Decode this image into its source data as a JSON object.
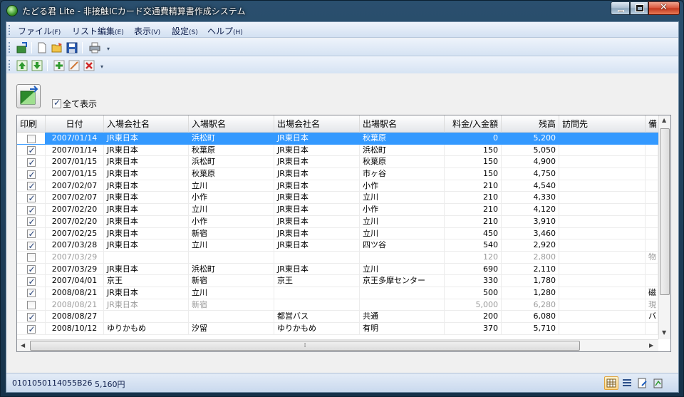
{
  "window": {
    "title": "たどる君  Lite - 非接触ICカード交通費精算書作成システム"
  },
  "menu": [
    {
      "label": "ファイル",
      "acc": "(F)"
    },
    {
      "label": "リスト編集",
      "acc": "(E)"
    },
    {
      "label": "表示",
      "acc": "(V)"
    },
    {
      "label": "設定",
      "acc": "(S)"
    },
    {
      "label": "ヘルプ",
      "acc": "(H)"
    }
  ],
  "toolbar1": [
    "import-icon",
    "new-icon",
    "open-icon",
    "save-icon",
    "print-icon"
  ],
  "toolbar2": [
    "move-up-icon",
    "move-down-icon",
    "add-row-icon",
    "edit-row-icon",
    "delete-row-icon"
  ],
  "show_all": {
    "label": "全て表示",
    "checked": true
  },
  "table": {
    "columns": [
      "印刷",
      "日付",
      "入場会社名",
      "入場駅名",
      "出場会社名",
      "出場駅名",
      "料金/入金額",
      "残高",
      "訪問先",
      "備"
    ],
    "rows": [
      {
        "print": false,
        "date": "2007/01/14",
        "in_co": "JR東日本",
        "in_st": "浜松町",
        "out_co": "JR東日本",
        "out_st": "秋葉原",
        "fare": "0",
        "bal": "5,200",
        "visit": "",
        "note": "",
        "selected": true
      },
      {
        "print": true,
        "date": "2007/01/14",
        "in_co": "JR東日本",
        "in_st": "秋葉原",
        "out_co": "JR東日本",
        "out_st": "浜松町",
        "fare": "150",
        "bal": "5,050",
        "visit": "",
        "note": ""
      },
      {
        "print": true,
        "date": "2007/01/15",
        "in_co": "JR東日本",
        "in_st": "浜松町",
        "out_co": "JR東日本",
        "out_st": "秋葉原",
        "fare": "150",
        "bal": "4,900",
        "visit": "",
        "note": ""
      },
      {
        "print": true,
        "date": "2007/01/15",
        "in_co": "JR東日本",
        "in_st": "秋葉原",
        "out_co": "JR東日本",
        "out_st": "市ヶ谷",
        "fare": "150",
        "bal": "4,750",
        "visit": "",
        "note": ""
      },
      {
        "print": true,
        "date": "2007/02/07",
        "in_co": "JR東日本",
        "in_st": "立川",
        "out_co": "JR東日本",
        "out_st": "小作",
        "fare": "210",
        "bal": "4,540",
        "visit": "",
        "note": ""
      },
      {
        "print": true,
        "date": "2007/02/07",
        "in_co": "JR東日本",
        "in_st": "小作",
        "out_co": "JR東日本",
        "out_st": "立川",
        "fare": "210",
        "bal": "4,330",
        "visit": "",
        "note": ""
      },
      {
        "print": true,
        "date": "2007/02/20",
        "in_co": "JR東日本",
        "in_st": "立川",
        "out_co": "JR東日本",
        "out_st": "小作",
        "fare": "210",
        "bal": "4,120",
        "visit": "",
        "note": ""
      },
      {
        "print": true,
        "date": "2007/02/20",
        "in_co": "JR東日本",
        "in_st": "小作",
        "out_co": "JR東日本",
        "out_st": "立川",
        "fare": "210",
        "bal": "3,910",
        "visit": "",
        "note": ""
      },
      {
        "print": true,
        "date": "2007/02/25",
        "in_co": "JR東日本",
        "in_st": "新宿",
        "out_co": "JR東日本",
        "out_st": "立川",
        "fare": "450",
        "bal": "3,460",
        "visit": "",
        "note": ""
      },
      {
        "print": true,
        "date": "2007/03/28",
        "in_co": "JR東日本",
        "in_st": "立川",
        "out_co": "JR東日本",
        "out_st": "四ツ谷",
        "fare": "540",
        "bal": "2,920",
        "visit": "",
        "note": ""
      },
      {
        "print": false,
        "date": "2007/03/29",
        "in_co": "",
        "in_st": "",
        "out_co": "",
        "out_st": "",
        "fare": "120",
        "bal": "2,800",
        "visit": "",
        "note": "物",
        "dim": true
      },
      {
        "print": true,
        "date": "2007/03/29",
        "in_co": "JR東日本",
        "in_st": "浜松町",
        "out_co": "JR東日本",
        "out_st": "立川",
        "fare": "690",
        "bal": "2,110",
        "visit": "",
        "note": ""
      },
      {
        "print": true,
        "date": "2007/04/01",
        "in_co": "京王",
        "in_st": "新宿",
        "out_co": "京王",
        "out_st": "京王多摩センター",
        "fare": "330",
        "bal": "1,780",
        "visit": "",
        "note": ""
      },
      {
        "print": true,
        "date": "2008/08/21",
        "in_co": "JR東日本",
        "in_st": "立川",
        "out_co": "",
        "out_st": "",
        "fare": "500",
        "bal": "1,280",
        "visit": "",
        "note": "磁"
      },
      {
        "print": false,
        "date": "2008/08/21",
        "in_co": "JR東日本",
        "in_st": "新宿",
        "out_co": "",
        "out_st": "",
        "fare": "5,000",
        "bal": "6,280",
        "visit": "",
        "note": "現",
        "dim": true
      },
      {
        "print": true,
        "date": "2008/08/27",
        "in_co": "",
        "in_st": "",
        "out_co": "都営バス",
        "out_st": "共通",
        "fare": "200",
        "bal": "6,080",
        "visit": "",
        "note": "バ"
      },
      {
        "print": true,
        "date": "2008/10/12",
        "in_co": "ゆりかもめ",
        "in_st": "汐留",
        "out_co": "ゆりかもめ",
        "out_st": "有明",
        "fare": "370",
        "bal": "5,710",
        "visit": "",
        "note": ""
      }
    ]
  },
  "status": {
    "card_id": "0101050114055B26",
    "balance": "5,160円"
  },
  "colors": {
    "selection": "#3399ff",
    "titlebar": "#2a4f6e"
  }
}
